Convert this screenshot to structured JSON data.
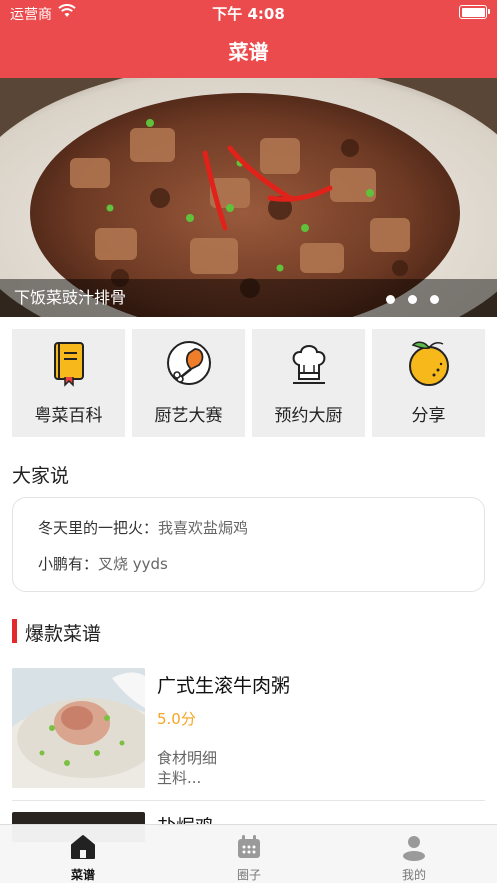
{
  "status_bar": {
    "carrier": "运营商",
    "time": "下午 4:08"
  },
  "nav": {
    "title": "菜谱"
  },
  "banner": {
    "caption": "下饭菜豉汁排骨",
    "page_count": 3
  },
  "tiles": [
    {
      "label": "粤菜百科",
      "icon": "book-icon"
    },
    {
      "label": "厨艺大赛",
      "icon": "drumstick-icon"
    },
    {
      "label": "预约大厨",
      "icon": "chef-hat-icon"
    },
    {
      "label": "分享",
      "icon": "orange-icon"
    }
  ],
  "comments_section": {
    "title": "大家说",
    "items": [
      {
        "user": "冬天里的一把火：",
        "text": "我喜欢盐焗鸡"
      },
      {
        "user": "小鹏有：",
        "text": "叉烧 yyds"
      }
    ]
  },
  "hot_section": {
    "title": "爆款菜谱",
    "recipes": [
      {
        "name": "广式生滚牛肉粥",
        "score": "5.0分",
        "detail_title": "食材明细",
        "detail_sub": "主料..."
      },
      {
        "name": "盐焗鸡"
      }
    ]
  },
  "tabbar": {
    "items": [
      {
        "label": "菜谱",
        "icon": "home-icon",
        "active": true
      },
      {
        "label": "圈子",
        "icon": "calendar-icon",
        "active": false
      },
      {
        "label": "我的",
        "icon": "person-icon",
        "active": false
      }
    ]
  },
  "colors": {
    "brand_red": "#ec4b4e",
    "score_orange": "#f5a623",
    "accent_bar": "#e22a2a"
  }
}
